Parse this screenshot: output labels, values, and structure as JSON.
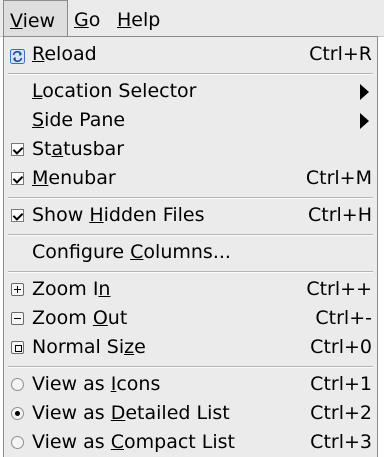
{
  "menubar": {
    "items": [
      {
        "pre": "",
        "mn": "V",
        "post": "iew"
      },
      {
        "pre": "",
        "mn": "G",
        "post": "o"
      },
      {
        "pre": "",
        "mn": "H",
        "post": "elp"
      }
    ]
  },
  "menu": {
    "reload": {
      "pre": "",
      "mn": "R",
      "post": "eload",
      "accel": "Ctrl+R",
      "icon": "reload-icon"
    },
    "location_selector": {
      "pre": "",
      "mn": "L",
      "post": "ocation Selector"
    },
    "side_pane": {
      "pre": "",
      "mn": "S",
      "post": "ide Pane"
    },
    "statusbar": {
      "pre": "St",
      "mn": "a",
      "post": "tusbar",
      "checked": true
    },
    "menubar": {
      "pre": "",
      "mn": "M",
      "post": "enubar",
      "accel": "Ctrl+M",
      "checked": true
    },
    "show_hidden": {
      "pre": "Show ",
      "mn": "H",
      "post": "idden Files",
      "accel": "Ctrl+H",
      "checked": true
    },
    "configure_columns": {
      "pre": "Configure ",
      "mn": "C",
      "post": "olumns..."
    },
    "zoom_in": {
      "pre": "Zoom I",
      "mn": "n",
      "post": "",
      "accel": "Ctrl++",
      "icon": "zoom-in-icon"
    },
    "zoom_out": {
      "pre": "Zoom ",
      "mn": "O",
      "post": "ut",
      "accel": "Ctrl+-",
      "icon": "zoom-out-icon"
    },
    "normal_size": {
      "pre": "Normal Si",
      "mn": "z",
      "post": "e",
      "accel": "Ctrl+0",
      "icon": "zoom-normal-icon"
    },
    "view_icons": {
      "pre": "View as ",
      "mn": "I",
      "post": "cons",
      "accel": "Ctrl+1",
      "selected": false
    },
    "view_detailed": {
      "pre": "View as ",
      "mn": "D",
      "post": "etailed List",
      "accel": "Ctrl+2",
      "selected": true
    },
    "view_compact": {
      "pre": "View as ",
      "mn": "C",
      "post": "ompact List",
      "accel": "Ctrl+3",
      "selected": false
    }
  },
  "colors": {
    "menu_bg": "#ebebeb",
    "border": "#8c8c8c",
    "reload_icon": "#3a6fc4"
  }
}
